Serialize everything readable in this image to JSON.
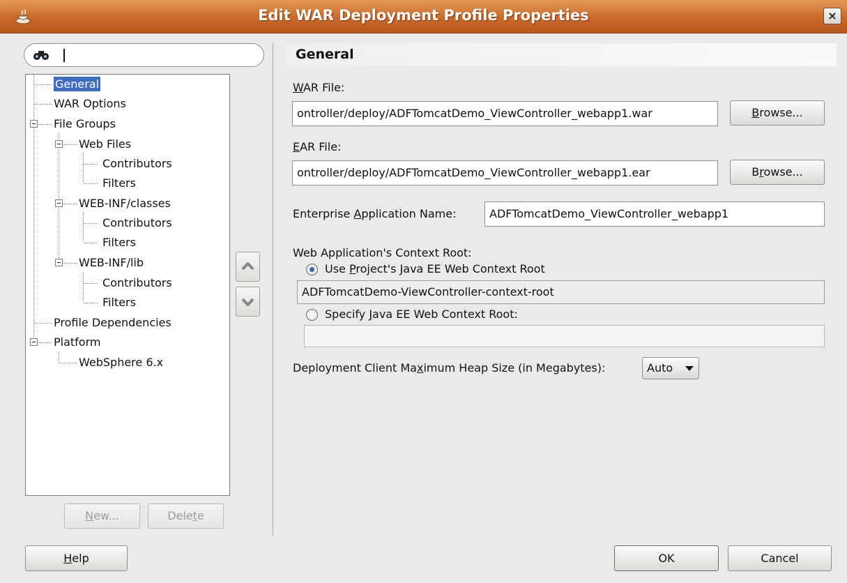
{
  "window": {
    "title": "Edit WAR Deployment Profile Properties",
    "close_label": "×",
    "icon": "java-cup-icon"
  },
  "search": {
    "value": "",
    "icon": "binoculars-icon"
  },
  "tree": {
    "items": [
      {
        "label": "General",
        "selected": true
      },
      {
        "label": "WAR Options"
      },
      {
        "label": "File Groups"
      },
      {
        "label": "Web Files"
      },
      {
        "label": "Contributors"
      },
      {
        "label": "Filters"
      },
      {
        "label": "WEB-INF/classes"
      },
      {
        "label": "Contributors"
      },
      {
        "label": "Filters"
      },
      {
        "label": "WEB-INF/lib"
      },
      {
        "label": "Contributors"
      },
      {
        "label": "Filters"
      },
      {
        "label": "Profile Dependencies"
      },
      {
        "label": "Platform"
      },
      {
        "label": "WebSphere 6.x"
      }
    ],
    "new_button": {
      "pre": "",
      "mn": "N",
      "post": "ew..."
    },
    "delete_button": {
      "pre": "Dele",
      "mn": "t",
      "post": "e"
    }
  },
  "main": {
    "header": "General",
    "war_file": {
      "label_mn": "W",
      "label_rest": "AR File:",
      "value": "ontroller/deploy/ADFTomcatDemo_ViewController_webapp1.war",
      "browse": {
        "pre": "",
        "mn": "B",
        "post": "rowse..."
      }
    },
    "ear_file": {
      "label_mn": "E",
      "label_rest": "AR File:",
      "value": "ontroller/deploy/ADFTomcatDemo_ViewController_webapp1.ear",
      "browse": {
        "pre": "B",
        "mn": "r",
        "post": "owse..."
      }
    },
    "enterprise_app": {
      "label_pre": "Enterprise ",
      "label_mn": "A",
      "label_post": "pplication Name:",
      "value": "ADFTomcatDemo_ViewController_webapp1"
    },
    "context_root": {
      "label": "Web Application's Context Root:",
      "use_project": {
        "pre": "Use ",
        "mn": "P",
        "post": "roject's Java EE Web Context Root",
        "checked": true
      },
      "project_value": "ADFTomcatDemo-ViewController-context-root",
      "specify": {
        "pre": "Specify ",
        "mn": "J",
        "post": "ava EE Web Context Root:",
        "checked": false
      },
      "specify_value": ""
    },
    "heap": {
      "label_pre": "Deployment Client Ma",
      "label_mn": "x",
      "label_post": "imum Heap Size (in Megabytes):",
      "selected": "Auto"
    }
  },
  "footer": {
    "help": {
      "mn": "H",
      "post": "elp"
    },
    "ok": "OK",
    "cancel": "Cancel"
  },
  "colors": {
    "titlebar": "#c8692a",
    "selection": "#3e6cc0"
  }
}
